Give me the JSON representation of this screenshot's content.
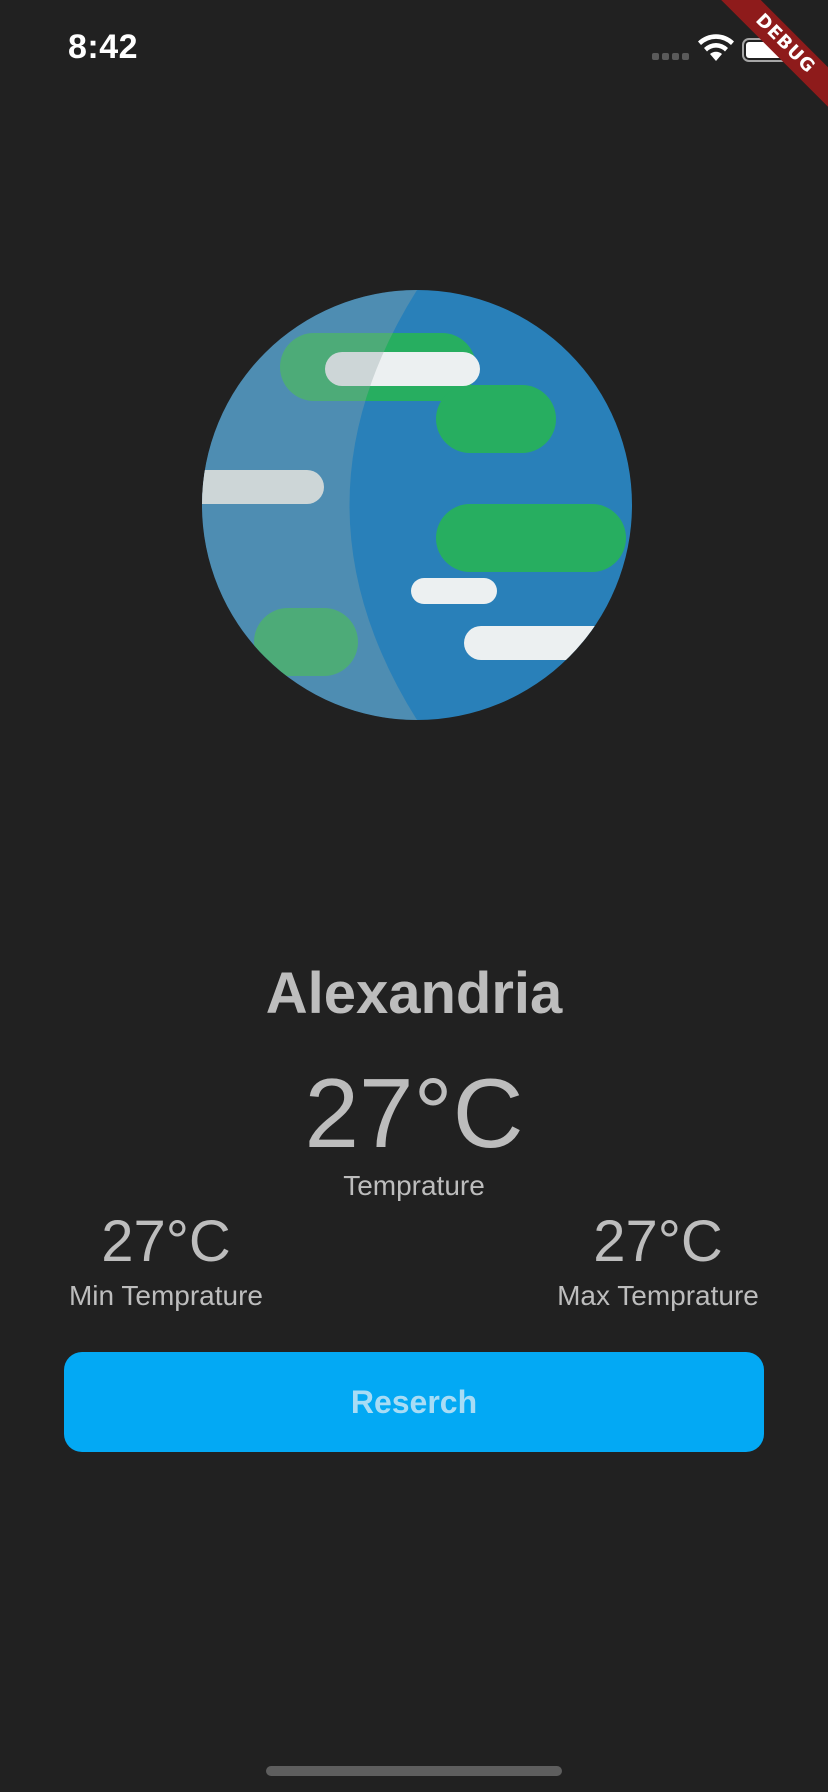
{
  "status_bar": {
    "time": "8:42",
    "signal_icon": "cellular-dots-icon",
    "wifi_icon": "wifi-icon",
    "battery_icon": "battery-icon"
  },
  "debug_banner": {
    "text": "DEBUG"
  },
  "weather": {
    "image_icon": "globe-icon",
    "city": "Alexandria",
    "temperature": "27°C",
    "temperature_label": "Temprature",
    "min_temperature": "27°C",
    "min_label": "Min Temprature",
    "max_temperature": "27°C",
    "max_label": "Max Temprature"
  },
  "actions": {
    "research_label": "Reserch"
  },
  "colors": {
    "background": "#212121",
    "text": "#bdbdbd",
    "button": "#03a9f4",
    "button_text": "#a8dcf5",
    "debug_banner": "#8e1b1b",
    "globe_ocean": "#2980b9",
    "globe_land": "#27ae60",
    "globe_cloud": "#ecf0f1"
  }
}
